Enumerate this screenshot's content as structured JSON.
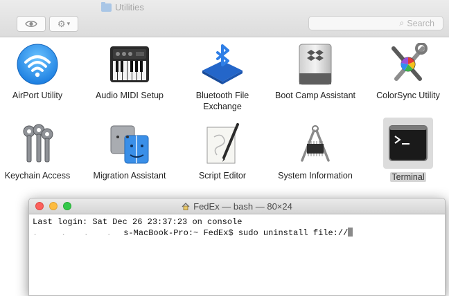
{
  "window": {
    "folder_title": "Utilities",
    "search_placeholder": "Search",
    "accent_color": "#2f8ef2"
  },
  "apps": [
    {
      "label": "AirPort Utility",
      "icon": "wifi-icon"
    },
    {
      "label": "Audio MIDI Setup",
      "icon": "piano-keyboard-icon"
    },
    {
      "label": "Bluetooth File Exchange",
      "icon": "bluetooth-icon"
    },
    {
      "label": "Boot Camp Assistant",
      "icon": "hard-drive-icon"
    },
    {
      "label": "ColorSync Utility",
      "icon": "colorsync-tools-icon"
    },
    {
      "label": "Keychain Access",
      "icon": "keys-icon"
    },
    {
      "label": "Migration Assistant",
      "icon": "migration-faces-icon"
    },
    {
      "label": "Script Editor",
      "icon": "script-pen-icon"
    },
    {
      "label": "System Information",
      "icon": "caliper-chip-icon"
    },
    {
      "label": "Terminal",
      "icon": "terminal-prompt-icon",
      "selected": true
    }
  ],
  "terminal": {
    "title": "FedEx — bash — 80×24",
    "line1": "Last login: Sat Dec 26 23:37:23 on console",
    "line2_prefix": "s-MacBook-Pro:~ FedEx$ ",
    "line2_command": "sudo uninstall file://"
  }
}
